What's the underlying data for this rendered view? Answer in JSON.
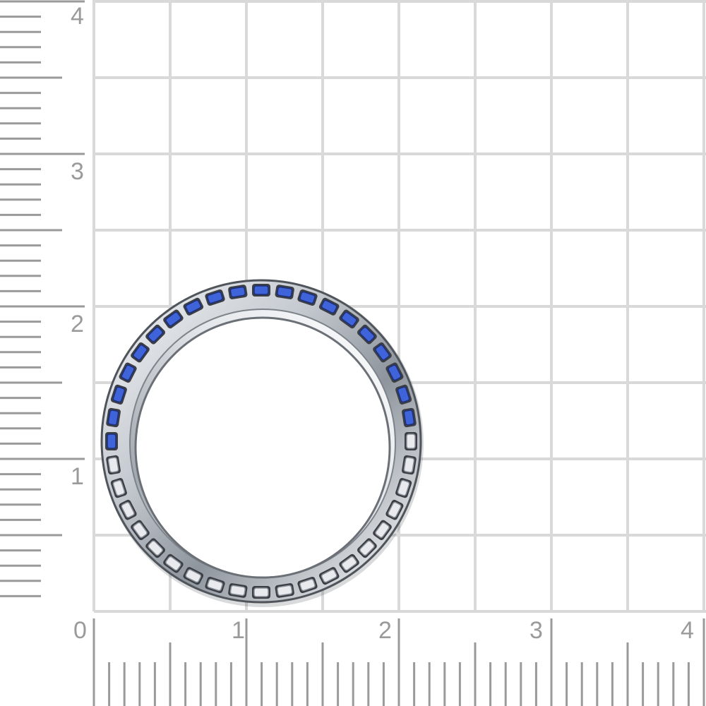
{
  "ruler_y": {
    "labels": [
      "4",
      "3",
      "2",
      "1"
    ]
  },
  "ruler_x": {
    "labels": [
      "0",
      "1",
      "2",
      "3",
      "4"
    ]
  },
  "ring": {
    "metal_color": "#b9bec4",
    "stone_color": "#3f63d8",
    "setting_color": "#e8eaed",
    "stone_count_visible": 40
  },
  "colors": {
    "grid_line": "#d9d9d9",
    "ruler_tick": "#9a9a9a",
    "background": "#ffffff"
  }
}
